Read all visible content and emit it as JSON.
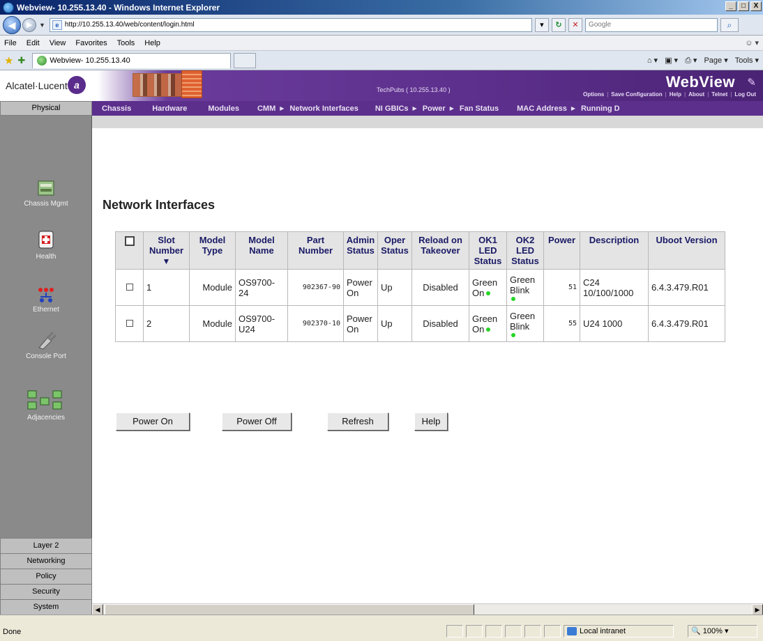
{
  "window": {
    "title": "Webview- 10.255.13.40 - Windows Internet Explorer",
    "controls": [
      "_",
      "□",
      "X"
    ]
  },
  "address": {
    "url": "http://10.255.13.40/web/content/login.html",
    "search_placeholder": "Google"
  },
  "menubar": {
    "items": [
      "File",
      "Edit",
      "View",
      "Favorites",
      "Tools",
      "Help"
    ]
  },
  "tabbar": {
    "tab_label": "Webview- 10.255.13.40",
    "commands": [
      "Page ▾",
      "Tools ▾"
    ]
  },
  "banner": {
    "logo": "Alcatel·Lucent",
    "host": "TechPubs ( 10.255.13.40 )",
    "title": "WebView",
    "links": [
      "Options",
      "Save Configuration",
      "Help",
      "About",
      "Telnet",
      "Log Out"
    ]
  },
  "nav": {
    "active_section": "Physical",
    "menu": [
      "Chassis",
      "Hardware",
      "Modules",
      "CMM",
      "Network Interfaces",
      "NI GBICs",
      "Power",
      "Fan Status",
      "MAC Address",
      "Running D"
    ]
  },
  "sidebar": {
    "items": [
      "Chassis Mgmt",
      "Health",
      "Ethernet",
      "Console Port",
      "Adjacencies"
    ],
    "bottom_tabs": [
      "Layer 2",
      "Networking",
      "Policy",
      "Security",
      "System"
    ]
  },
  "page": {
    "title": "Network Interfaces"
  },
  "table": {
    "headers": [
      "Slot Number",
      "Model Type",
      "Model Name",
      "Part Number",
      "Admin Status",
      "Oper Status",
      "Reload on Takeover",
      "OK1 LED Status",
      "OK2 LED Status",
      "Power",
      "Description",
      "Uboot Version"
    ],
    "rows": [
      {
        "slot": "1",
        "model_type": "Module",
        "model_name": "OS9700-24",
        "part_number": "902367-90",
        "admin_status": "Power On",
        "oper_status": "Up",
        "reload": "Disabled",
        "ok1": "Green On",
        "ok2": "Green Blink",
        "power": "51",
        "description": "C24 10/100/1000",
        "uboot": "6.4.3.479.R01"
      },
      {
        "slot": "2",
        "model_type": "Module",
        "model_name": "OS9700-U24",
        "part_number": "902370-10",
        "admin_status": "Power On",
        "oper_status": "Up",
        "reload": "Disabled",
        "ok1": "Green On",
        "ok2": "Green Blink",
        "power": "55",
        "description": "U24 1000",
        "uboot": "6.4.3.479.R01"
      }
    ]
  },
  "buttons": {
    "power_on": "Power On",
    "power_off": "Power Off",
    "refresh": "Refresh",
    "help": "Help"
  },
  "status": {
    "text": "Done",
    "zone": "Local intranet",
    "zoom": "100%"
  },
  "colors": {
    "banner_purple": "#5c2f8c",
    "led_green": "#25d425",
    "sidebar_gray": "#8a8a8a"
  }
}
